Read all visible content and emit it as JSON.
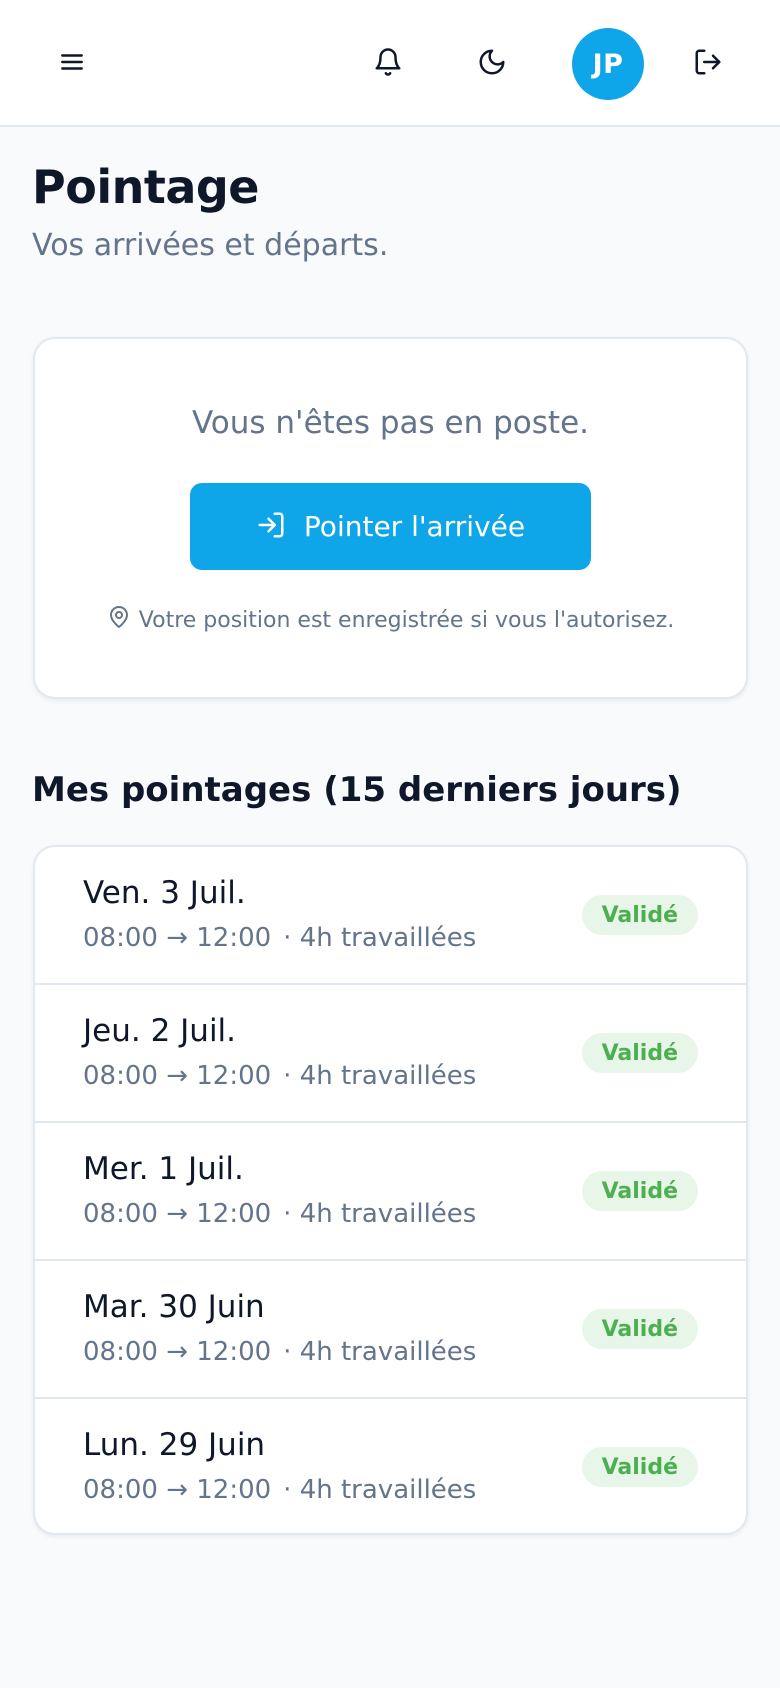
{
  "header": {
    "menu_icon": "menu-icon",
    "bell_icon": "bell-icon",
    "theme_icon": "moon-icon",
    "avatar_initials": "JP",
    "logout_icon": "logout-icon"
  },
  "page": {
    "title": "Pointage",
    "subtitle": "Vos arrivées et départs."
  },
  "clock_card": {
    "status_text": "Vous n'êtes pas en poste.",
    "button_label": "Pointer l'arrivée",
    "button_icon": "login-icon",
    "geo_icon": "map-pin-icon",
    "geo_note": "Votre position est enregistrée si vous l'autorisez."
  },
  "history": {
    "title": "Mes pointages (15 derniers jours)",
    "rows": [
      {
        "date": "Ven. 3 Juil.",
        "times": "08:00 → 12:00",
        "worked": "· 4h travaillées",
        "status": "Validé"
      },
      {
        "date": "Jeu. 2 Juil.",
        "times": "08:00 → 12:00",
        "worked": "· 4h travaillées",
        "status": "Validé"
      },
      {
        "date": "Mer. 1 Juil.",
        "times": "08:00 → 12:00",
        "worked": "· 4h travaillées",
        "status": "Validé"
      },
      {
        "date": "Mar. 30 Juin",
        "times": "08:00 → 12:00",
        "worked": "· 4h travaillées",
        "status": "Validé"
      },
      {
        "date": "Lun. 29 Juin",
        "times": "08:00 → 12:00",
        "worked": "· 4h travaillées",
        "status": "Validé"
      }
    ]
  },
  "colors": {
    "accent": "#0ea5e9",
    "status_validated_bg": "#e8f5e9",
    "status_validated_text": "#4caf50"
  }
}
